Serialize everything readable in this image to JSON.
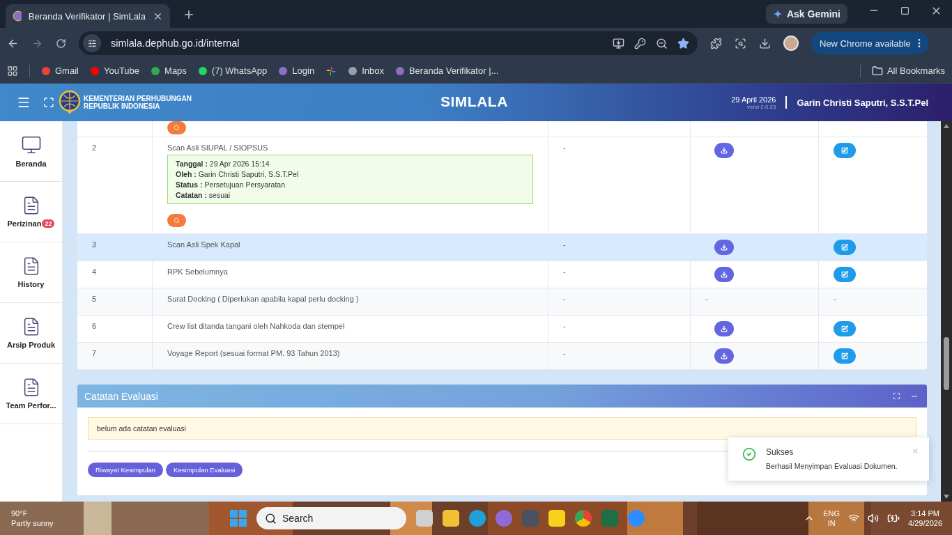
{
  "browser": {
    "tab_title": "Beranda Verifikator | SimLala",
    "url": "simlala.dephub.go.id/internal",
    "ask_gemini": "Ask Gemini",
    "update_button": "New Chrome available",
    "all_bookmarks": "All Bookmarks",
    "bookmarks": [
      {
        "label": "Gmail",
        "kind": "gmail"
      },
      {
        "label": "YouTube",
        "kind": "youtube"
      },
      {
        "label": "Maps",
        "kind": "maps"
      },
      {
        "label": "(7) WhatsApp",
        "kind": "whatsapp"
      },
      {
        "label": "Login",
        "kind": "site"
      },
      {
        "kind": "photos"
      },
      {
        "label": "Inbox",
        "kind": "mail"
      },
      {
        "label": "Beranda Verifikator |...",
        "kind": "site"
      }
    ]
  },
  "header": {
    "org_lines": [
      "KEMENTERIAN PERHUBUNGAN",
      "REPUBLIK INDONESIA"
    ],
    "title": "SIMLALA",
    "date": "29 April 2026",
    "version": "versi 2.0.23",
    "user": "Garin Christi Saputri, S.S.T.Pel"
  },
  "sidebar": {
    "items": [
      {
        "label": "Beranda",
        "kind": "monitor"
      },
      {
        "label": "Perizinan",
        "kind": "document",
        "badge": "22"
      },
      {
        "label": "History",
        "kind": "document"
      },
      {
        "label": "Arsip Produk",
        "kind": "document"
      },
      {
        "label": "Team Perfor...",
        "kind": "document"
      }
    ]
  },
  "table": {
    "top_row": {
      "search": true
    },
    "rows": [
      {
        "no": "2",
        "name": "Scan Asli SIUPAL / SIOPSUS",
        "history": [
          "**Tanggal :** 29 Apr 2026 15:14",
          "**Oleh :** Garin Christi Saputri, S.S.T.Pel",
          "**Status :** Persetujuan Persyaratan",
          "**Catatan :** sesuai"
        ],
        "search": true,
        "column_3": "-",
        "actions": [
          {
            "kind": "download"
          },
          {
            "kind": "edit"
          }
        ],
        "selected": false
      },
      {
        "no": "3",
        "name": "Scan Asli Spek Kapal",
        "search": false,
        "column_3": "-",
        "actions": [
          {
            "kind": "download"
          },
          {
            "kind": "edit"
          }
        ],
        "selected": true
      },
      {
        "no": "4",
        "name": "RPK Sebelumnya",
        "search": false,
        "column_3": "-",
        "actions": [
          {
            "kind": "download"
          },
          {
            "kind": "edit"
          }
        ],
        "selected": false
      },
      {
        "no": "5",
        "name": "Surat Docking ( Diperlukan apabila kapal perlu docking )",
        "search": false,
        "column_3": "-",
        "actions": [
          {
            "kind": "text",
            "text": "-"
          },
          {
            "kind": "text",
            "text": "-"
          }
        ],
        "selected": false
      },
      {
        "no": "6",
        "name": "Crew list ditanda tangani oleh Nahkoda dan stempel",
        "search": false,
        "column_3": "-",
        "actions": [
          {
            "kind": "download"
          },
          {
            "kind": "edit"
          }
        ],
        "selected": false
      },
      {
        "no": "7",
        "name": "Voyage Report (sesuai format PM. 93 Tahun 2013)",
        "search": false,
        "column_3": "-",
        "actions": [
          {
            "kind": "download"
          },
          {
            "kind": "edit"
          }
        ],
        "selected": false
      }
    ]
  },
  "evaluation": {
    "title": "Catatan Evaluasi",
    "note": "belum ada catatan evaluasi",
    "buttons": [
      "Riwayat Kesimpulan",
      "Kesimpulan Evaluasi"
    ]
  },
  "toast": {
    "title": "Sukses",
    "message": "Berhasil Menyimpan Evaluasi Dokumen."
  },
  "taskbar": {
    "temperature": "90°F",
    "weather": "Partly sunny",
    "search": "Search",
    "language": [
      "ENG",
      "IN"
    ],
    "time": "3:14 PM",
    "date": "4/29/2026"
  }
}
